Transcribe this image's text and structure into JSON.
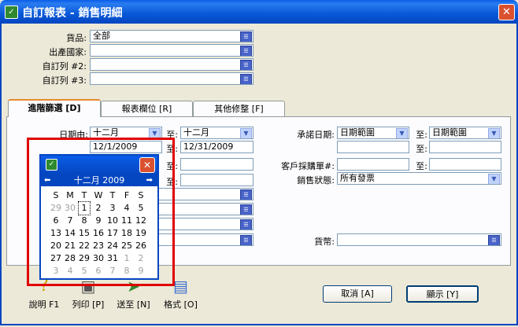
{
  "window": {
    "title": "自訂報表 - 銷售明細",
    "close": "✕"
  },
  "top_fields": [
    {
      "label": "貨品:",
      "value": "全部"
    },
    {
      "label": "出產國家:",
      "value": ""
    },
    {
      "label": "自訂列 #2:",
      "value": ""
    },
    {
      "label": "自訂列 #3:",
      "value": ""
    }
  ],
  "tabs": [
    "進階篩選 [D]",
    "報表欄位 [R]",
    "其他修整 [F]"
  ],
  "filter": {
    "date_label": "日期由:",
    "date_from_select": "十二月",
    "to": "至:",
    "date_to_select": "十二月",
    "date_from": "12/1/2009",
    "date_to": "12/31/2009",
    "promise_label": "承諾日期:",
    "promise_from": "日期範圍",
    "promise_to": "日期範圍",
    "po_label": "客戶採購單#:",
    "status_label": "銷售狀態:",
    "status_value": "所有發票",
    "currency_label": "貨幣:"
  },
  "calendar": {
    "month_title": "十二月 2009",
    "weekdays": [
      "S",
      "M",
      "T",
      "W",
      "T",
      "F",
      "S"
    ],
    "weeks": [
      [
        "29",
        "30",
        "1",
        "2",
        "3",
        "4",
        "5"
      ],
      [
        "6",
        "7",
        "8",
        "9",
        "10",
        "11",
        "12"
      ],
      [
        "13",
        "14",
        "15",
        "16",
        "17",
        "18",
        "19"
      ],
      [
        "20",
        "21",
        "22",
        "23",
        "24",
        "25",
        "26"
      ],
      [
        "27",
        "28",
        "29",
        "30",
        "31",
        "1",
        "2"
      ],
      [
        "3",
        "4",
        "5",
        "6",
        "7",
        "8",
        "9"
      ]
    ]
  },
  "toolbar": {
    "help": "說明 F1",
    "print": "列印 [P]",
    "send": "送至 [N]",
    "format": "格式 [O]"
  },
  "buttons": {
    "cancel": "取消 [A]",
    "display": "顯示 [Y]"
  }
}
